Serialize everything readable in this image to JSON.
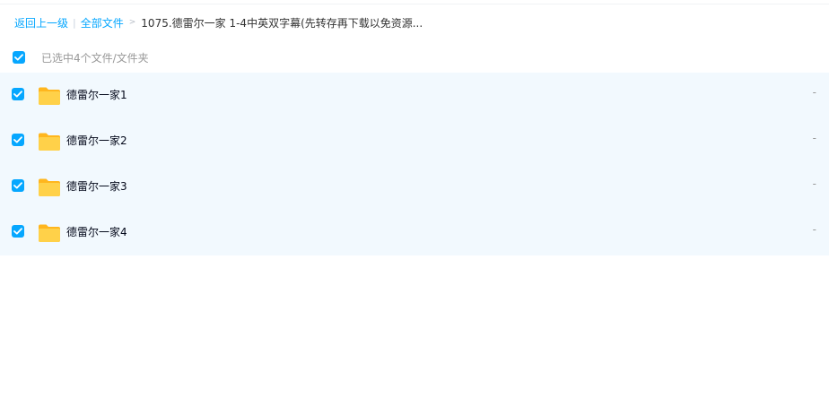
{
  "breadcrumb": {
    "back_label": "返回上一级",
    "separator": "|",
    "all_files_label": "全部文件",
    "arrow": ">",
    "current_folder": "1075.德雷尔一家 1-4中英双字幕(先转存再下载以免资源..."
  },
  "selection": {
    "all_checked": true,
    "summary": "已选中4个文件/文件夹"
  },
  "files": [
    {
      "name": "德雷尔一家1",
      "size": "-",
      "checked": true,
      "icon": "folder-icon"
    },
    {
      "name": "德雷尔一家2",
      "size": "-",
      "checked": true,
      "icon": "folder-icon"
    },
    {
      "name": "德雷尔一家3",
      "size": "-",
      "checked": true,
      "icon": "folder-icon"
    },
    {
      "name": "德雷尔一家4",
      "size": "-",
      "checked": true,
      "icon": "folder-icon"
    }
  ],
  "colors": {
    "accent": "#06a7ff",
    "row_bg": "#f2f9fe",
    "folder": "#ffc933"
  }
}
